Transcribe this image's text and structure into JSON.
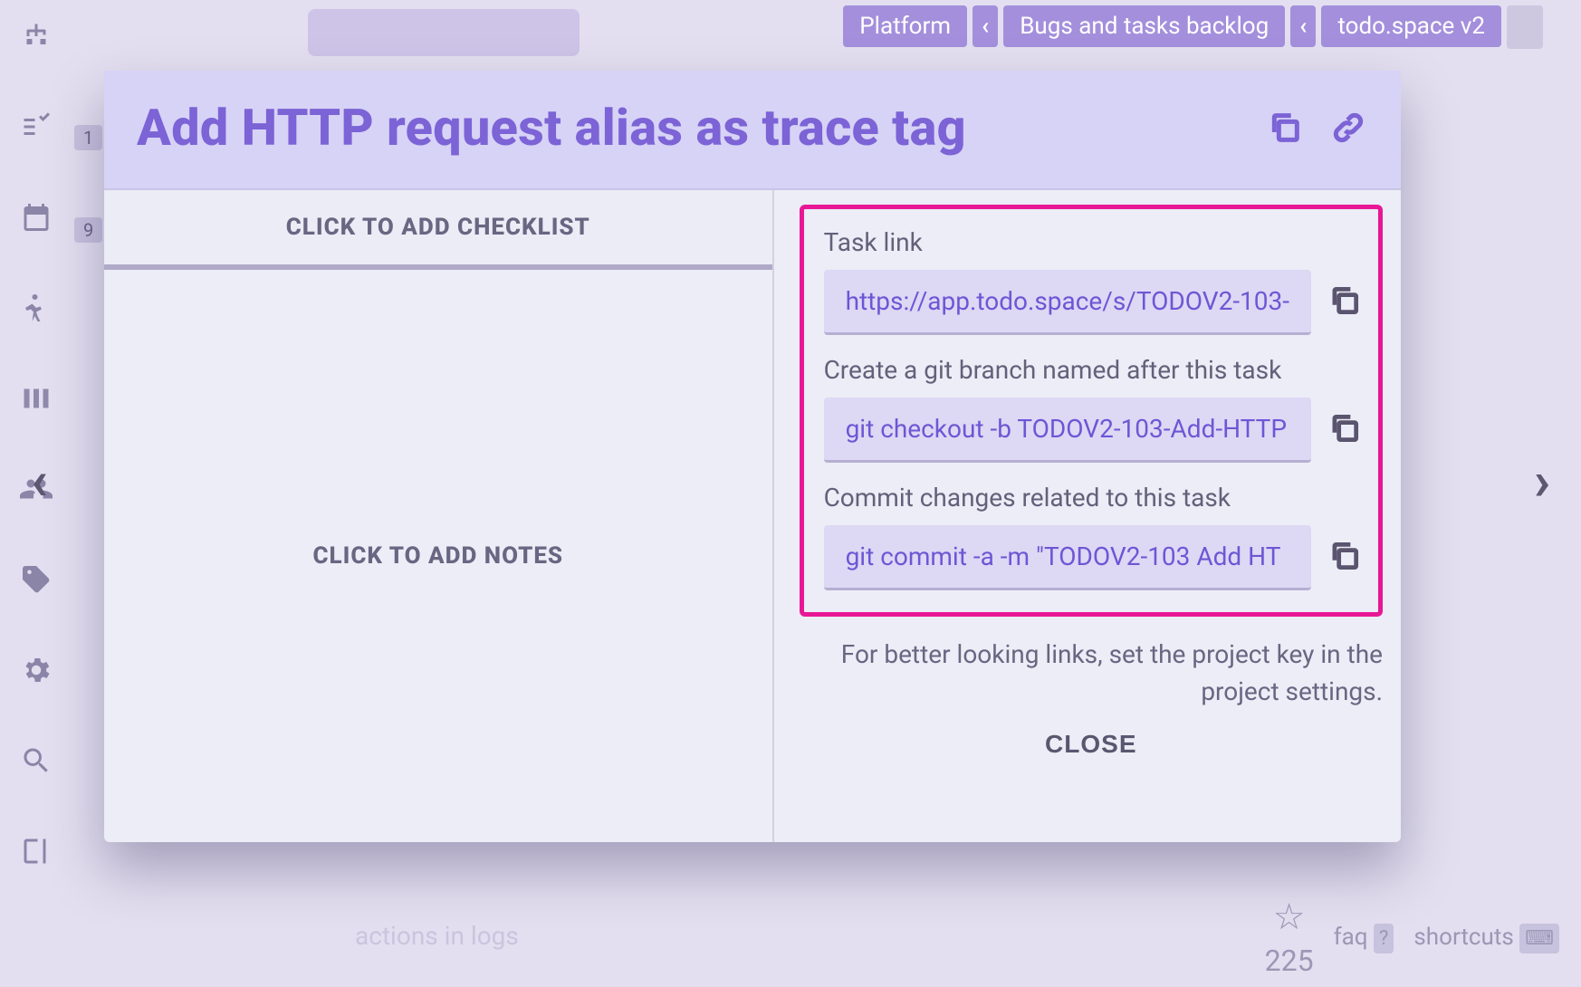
{
  "crumbs": {
    "a": "Platform",
    "b": "Bugs and tasks backlog",
    "c": "todo.space v2"
  },
  "modal": {
    "title": "Add HTTP request alias as trace tag",
    "checklist_placeholder": "CLICK TO ADD CHECKLIST",
    "notes_placeholder": "CLICK TO ADD NOTES",
    "snippets": {
      "task_link": {
        "label": "Task link",
        "value": "https://app.todo.space/s/TODOV2-103-"
      },
      "branch": {
        "label": "Create a git branch named after this task",
        "value": "git checkout -b TODOV2-103-Add-HTTP"
      },
      "commit": {
        "label": "Commit changes related to this task",
        "value": "git commit -a -m \"TODOV2-103 Add HT"
      }
    },
    "hint": "For better looking links, set the project key in the project settings.",
    "close": "CLOSE"
  },
  "sidebar": {
    "badge_tasks": "1",
    "badge_cal": "9"
  },
  "footer": {
    "count": "225",
    "faq": "faq",
    "shortcuts": "shortcuts"
  },
  "background": {
    "card_text": "actions in logs"
  }
}
